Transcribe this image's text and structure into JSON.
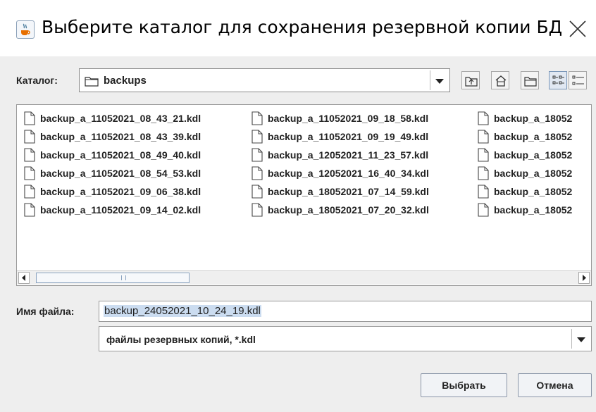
{
  "window": {
    "title": "Выберите каталог для сохранения резервной копии БД",
    "icon": "java-cup-icon"
  },
  "directory": {
    "label": "Каталог:",
    "value": "backups"
  },
  "toolbar": {
    "buttons": [
      "up-folder-icon",
      "home-icon",
      "new-folder-icon",
      "list-view-icon",
      "details-view-icon"
    ]
  },
  "files": {
    "columns": [
      [
        "backup_a_11052021_08_43_21.kdl",
        "backup_a_11052021_08_43_39.kdl",
        "backup_a_11052021_08_49_40.kdl",
        "backup_a_11052021_08_54_53.kdl",
        "backup_a_11052021_09_06_38.kdl",
        "backup_a_11052021_09_14_02.kdl"
      ],
      [
        "backup_a_11052021_09_18_58.kdl",
        "backup_a_11052021_09_19_49.kdl",
        "backup_a_12052021_11_23_57.kdl",
        "backup_a_12052021_16_40_34.kdl",
        "backup_a_18052021_07_14_59.kdl",
        "backup_a_18052021_07_20_32.kdl"
      ],
      [
        "backup_a_18052",
        "backup_a_18052",
        "backup_a_18052",
        "backup_a_18052",
        "backup_a_18052",
        "backup_a_18052"
      ]
    ]
  },
  "filename": {
    "label": "Имя файла:",
    "value": "backup_24052021_10_24_19.kdl"
  },
  "filter": {
    "value": "файлы резервных копий, *.kdl"
  },
  "buttons": {
    "select": "Выбрать",
    "cancel": "Отмена"
  }
}
